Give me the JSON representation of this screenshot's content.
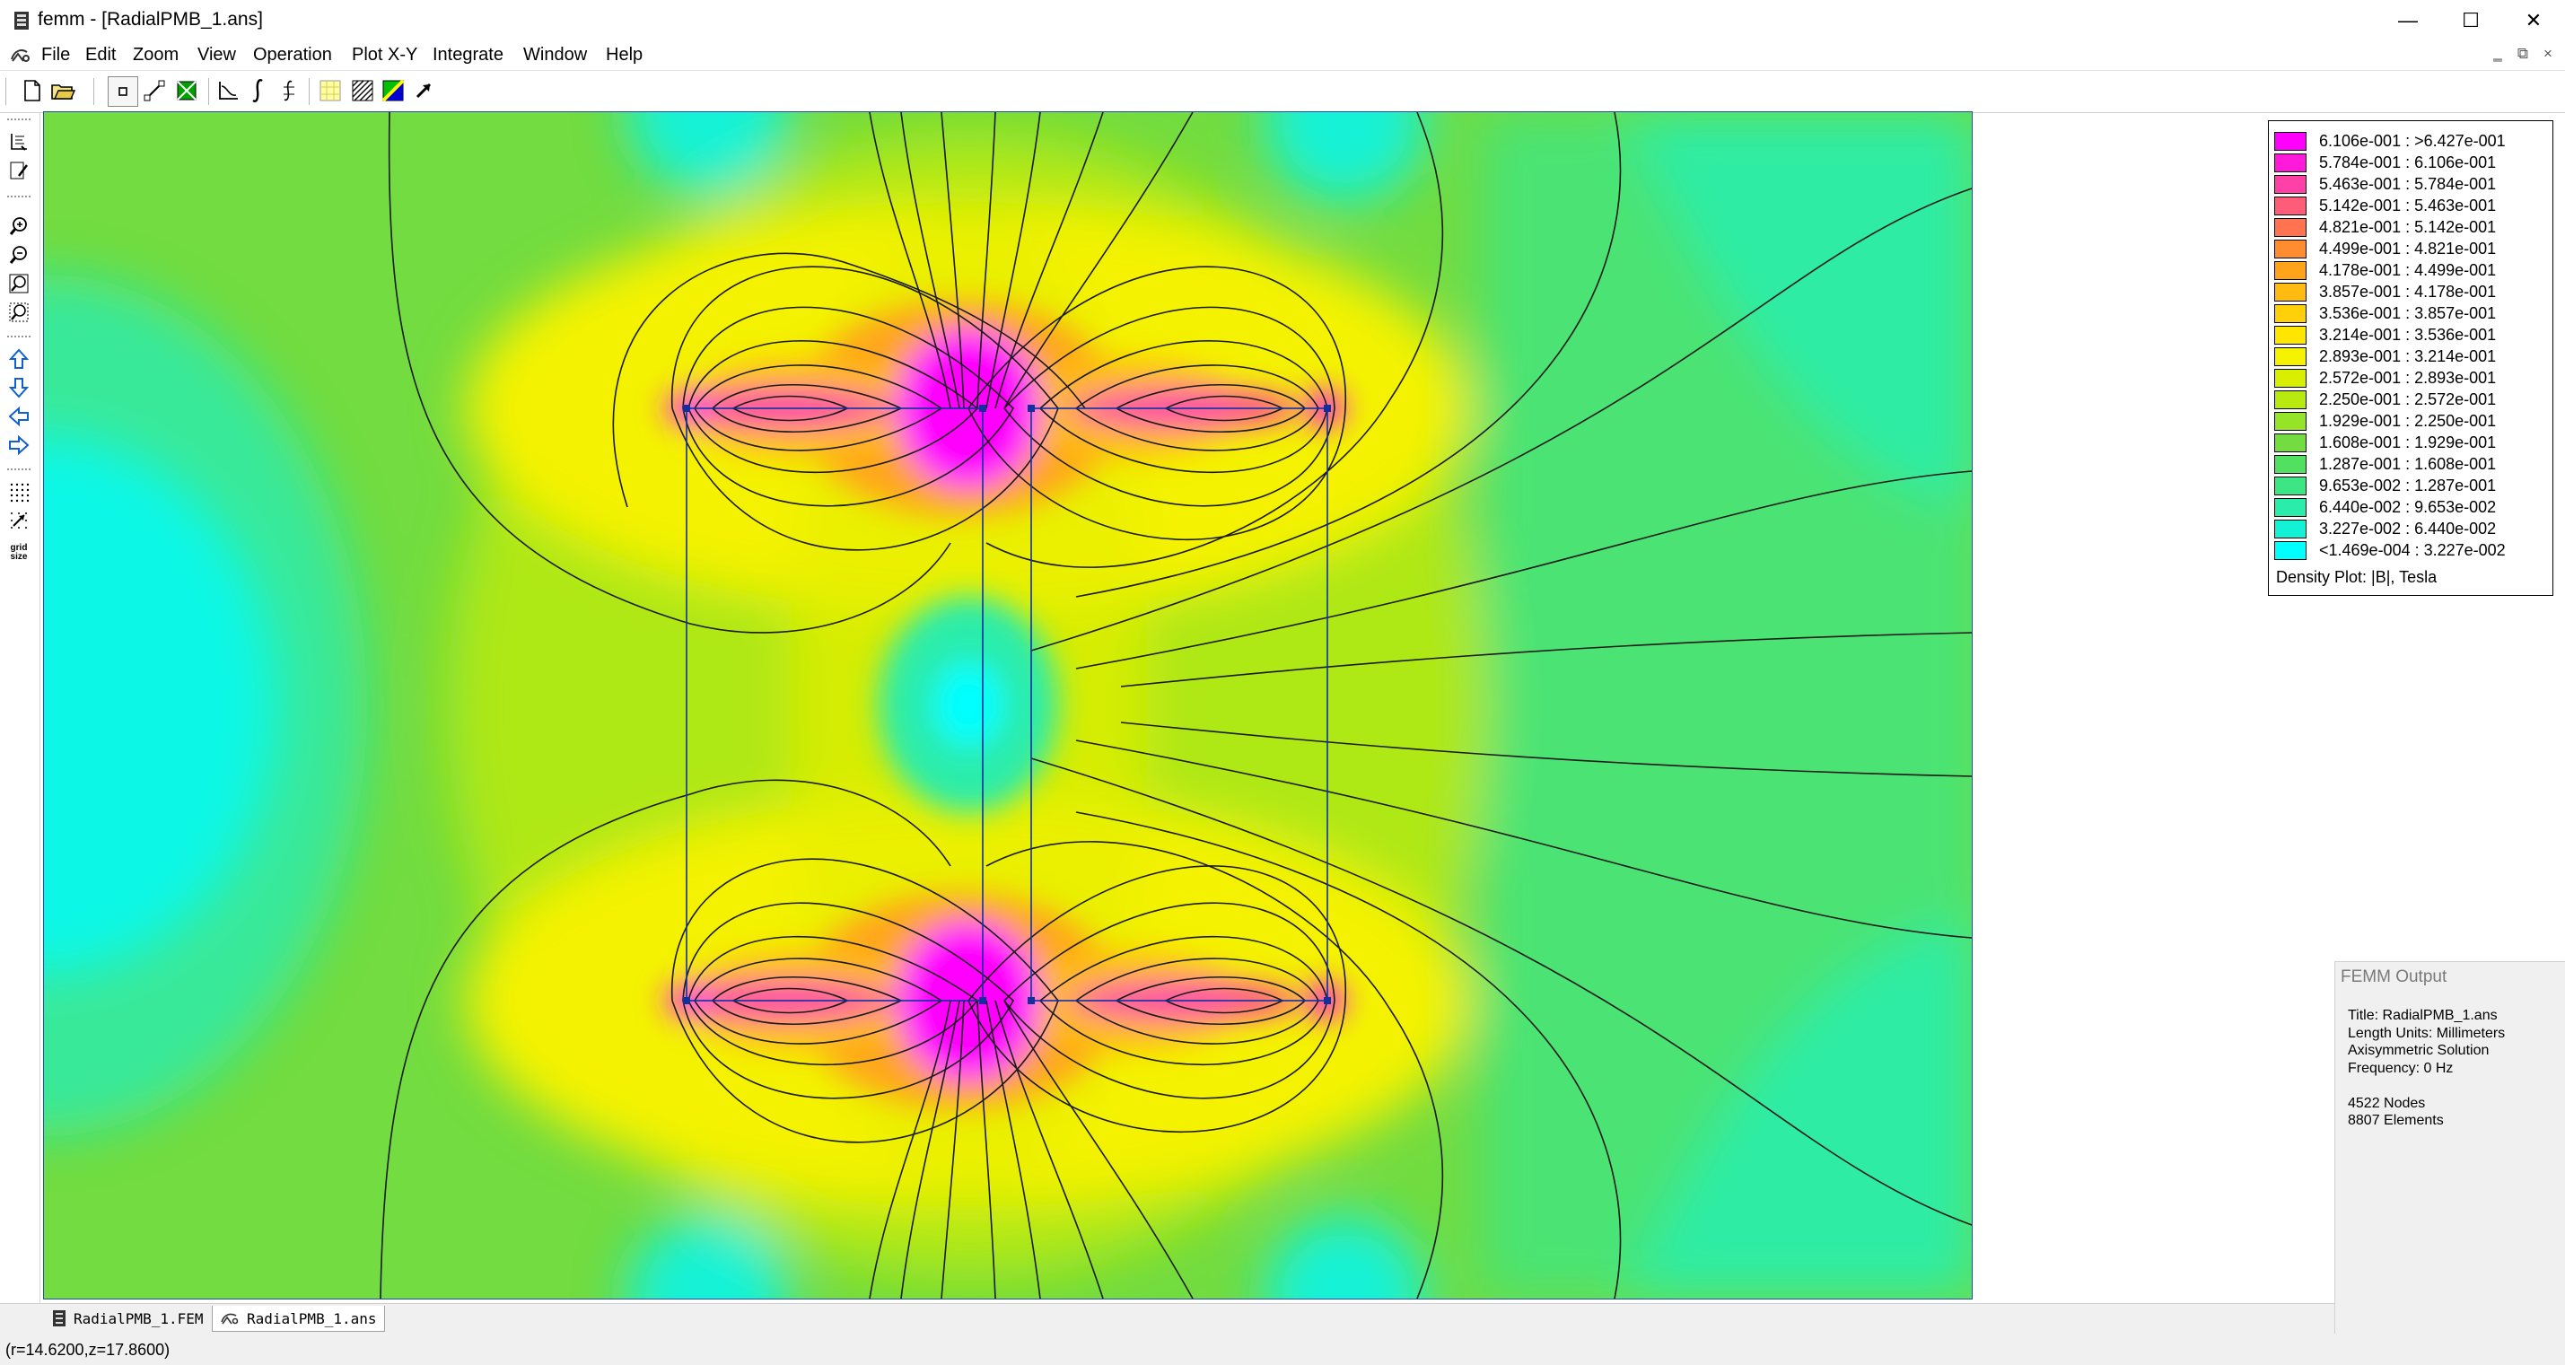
{
  "window": {
    "title": "femm - [RadialPMB_1.ans]",
    "minimize_glyph": "—",
    "maximize_glyph": "☐",
    "close_glyph": "✕"
  },
  "menu": {
    "items": [
      "File",
      "Edit",
      "Zoom",
      "View",
      "Operation",
      "Plot X-Y",
      "Integrate",
      "Window",
      "Help"
    ],
    "mdi_minimize": "‗",
    "mdi_restore": "⧉",
    "mdi_close": "×"
  },
  "toolbar": {
    "icons": [
      "new-file-icon",
      "open-file-icon",
      "point-mode-icon",
      "contour-mode-icon",
      "area-mode-icon",
      "plot-xy-icon",
      "integrate-icon",
      "line-integral-icon",
      "contour-plot-icon",
      "density-plot-icon",
      "vector-plot-icon",
      "pointer-icon"
    ]
  },
  "side_toolbar": {
    "icons": [
      "show-mesh-icon",
      "edit-icon",
      "zoom-in-icon",
      "zoom-out-icon",
      "zoom-natural-icon",
      "zoom-window-icon",
      "pan-up-icon",
      "pan-down-icon",
      "pan-left-icon",
      "pan-right-icon",
      "show-grid-icon",
      "snap-grid-icon"
    ],
    "grid_size_label": "grid size"
  },
  "legend": {
    "title": "Density Plot: |B|, Tesla",
    "rows": [
      {
        "label": "6.106e-001 : >6.427e-001",
        "color": "#ff00ff"
      },
      {
        "label": "5.784e-001 : 6.106e-001",
        "color": "#ff1ad9"
      },
      {
        "label": "5.463e-001 : 5.784e-001",
        "color": "#ff40a6"
      },
      {
        "label": "5.142e-001 : 5.463e-001",
        "color": "#ff5c7a"
      },
      {
        "label": "4.821e-001 : 5.142e-001",
        "color": "#ff7350"
      },
      {
        "label": "4.499e-001 : 4.821e-001",
        "color": "#ff8c2e"
      },
      {
        "label": "4.178e-001 : 4.499e-001",
        "color": "#ffa41a"
      },
      {
        "label": "3.857e-001 : 4.178e-001",
        "color": "#ffbb10"
      },
      {
        "label": "3.536e-001 : 3.857e-001",
        "color": "#ffd00a"
      },
      {
        "label": "3.214e-001 : 3.536e-001",
        "color": "#ffe600"
      },
      {
        "label": "2.893e-001 : 3.214e-001",
        "color": "#f4f200"
      },
      {
        "label": "2.572e-001 : 2.893e-001",
        "color": "#d8f000"
      },
      {
        "label": "2.250e-001 : 2.572e-001",
        "color": "#b8ea10"
      },
      {
        "label": "1.929e-001 : 2.250e-001",
        "color": "#95e428"
      },
      {
        "label": "1.608e-001 : 1.929e-001",
        "color": "#72dc40"
      },
      {
        "label": "1.287e-001 : 1.608e-001",
        "color": "#52e060"
      },
      {
        "label": "9.653e-002 : 1.287e-001",
        "color": "#3de685"
      },
      {
        "label": "6.440e-002 : 9.653e-002",
        "color": "#2aecab"
      },
      {
        "label": "3.227e-002 : 6.440e-002",
        "color": "#14f2d6"
      },
      {
        "label": "<1.469e-004 : 3.227e-002",
        "color": "#00ffff"
      }
    ]
  },
  "output": {
    "title": "FEMM Output",
    "lines": [
      "Title: RadialPMB_1.ans",
      "Length Units: Millimeters",
      "Axisymmetric Solution",
      "Frequency: 0 Hz",
      "",
      "4522 Nodes",
      "8807 Elements"
    ]
  },
  "tabs": [
    {
      "label": "RadialPMB_1.FEM",
      "active": false
    },
    {
      "label": "RadialPMB_1.ans",
      "active": true
    }
  ],
  "status": {
    "coords": "(r=14.6200,z=17.8600)"
  }
}
